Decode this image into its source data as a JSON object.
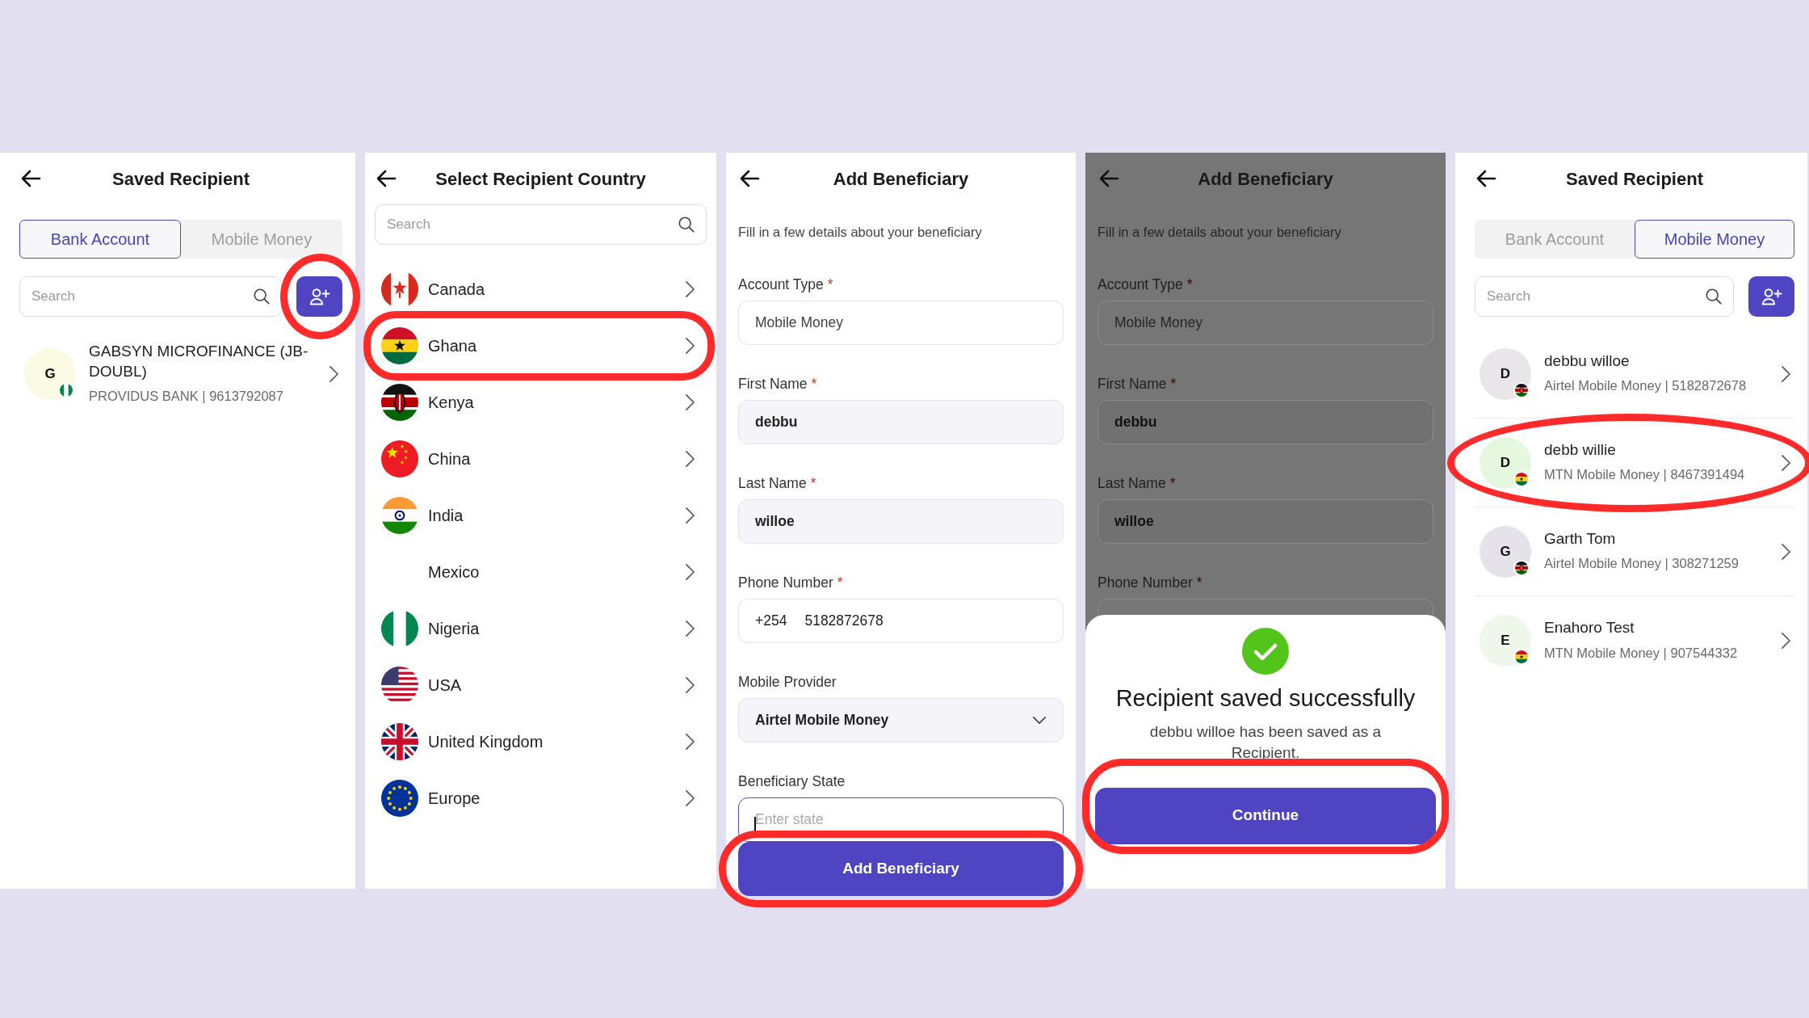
{
  "screens": [
    {
      "kind": "recipients",
      "title": "Saved Recipient",
      "tabs": [
        {
          "label": "Bank Account",
          "selected": true
        },
        {
          "label": "Mobile Money",
          "selected": false
        }
      ],
      "search": {
        "placeholder": "Search"
      },
      "add_button": {
        "highlighted": true
      },
      "recipients": [
        {
          "initial": "G",
          "name": "GABSYN MICROFINANCE (JB-DOUBL)",
          "detail": "PROVIDUS BANK | 9613792087",
          "color": "#fbfbe4",
          "kind": "nigeria",
          "highlighted": false
        }
      ]
    },
    {
      "kind": "countries",
      "title": "Select Recipient Country",
      "search": {
        "placeholder": "Search"
      },
      "countries": [
        {
          "name": "Canada",
          "kind": "canada",
          "highlighted": false
        },
        {
          "name": "Ghana",
          "kind": "ghana",
          "highlighted": true
        },
        {
          "name": "Kenya",
          "kind": "kenya",
          "highlighted": false
        },
        {
          "name": "China",
          "kind": "china",
          "highlighted": false
        },
        {
          "name": "India",
          "kind": "india",
          "highlighted": false
        },
        {
          "name": "Mexico",
          "highlighted": false
        },
        {
          "name": "Nigeria",
          "kind": "nigeria",
          "highlighted": false
        },
        {
          "name": "USA",
          "kind": "usa",
          "highlighted": false
        },
        {
          "name": "United Kingdom",
          "kind": "uk",
          "highlighted": false
        },
        {
          "name": "Europe",
          "kind": "europe",
          "highlighted": false
        }
      ]
    },
    {
      "kind": "form",
      "title": "Add Beneficiary",
      "dimmed": false,
      "subtitle": "Fill in a few details about your beneficiary",
      "fields": [
        {
          "kind": "static",
          "label": "Account Type",
          "required_mark": "*",
          "value": "Mobile Money"
        },
        {
          "kind": "text",
          "label": "First Name",
          "required_mark": "*",
          "value": "debbu"
        },
        {
          "kind": "text",
          "label": "Last Name",
          "required_mark": "*",
          "value": "willoe"
        },
        {
          "kind": "phone",
          "label": "Phone Number",
          "required_mark": "*",
          "prefix": "+254",
          "value": "5182872678"
        },
        {
          "kind": "select",
          "label": "Mobile Provider",
          "value": "Airtel Mobile Money"
        },
        {
          "kind": "input",
          "label": "Beneficiary State",
          "placeholder": "Enter state",
          "focused": true
        }
      ],
      "submit": {
        "label": "Add Beneficiary",
        "highlighted": true
      }
    },
    {
      "kind": "form",
      "title": "Add Beneficiary",
      "dimmed": true,
      "subtitle": "Fill in a few details about your beneficiary",
      "fields": [
        {
          "kind": "static",
          "label": "Account Type",
          "required_mark": "*",
          "value": "Mobile Money"
        },
        {
          "kind": "text",
          "label": "First Name",
          "required_mark": "*",
          "value": "debbu"
        },
        {
          "kind": "text",
          "label": "Last Name",
          "required_mark": "*",
          "value": "willoe"
        },
        {
          "kind": "phone",
          "label": "Phone Number",
          "required_mark": "*"
        }
      ],
      "dialog": {
        "title": "Recipient saved successfully",
        "message": "debbu willoe has been saved as a Recipient.",
        "button": {
          "label": "Continue",
          "highlighted": true
        }
      }
    },
    {
      "kind": "recipients",
      "title": "Saved Recipient",
      "tabs": [
        {
          "label": "Bank Account",
          "selected": false
        },
        {
          "label": "Mobile Money",
          "selected": true
        }
      ],
      "search": {
        "placeholder": "Search"
      },
      "add_button": {
        "highlighted": false
      },
      "recipients": [
        {
          "initial": "D",
          "name": "debbu willoe",
          "detail": "Airtel Mobile Money | 5182872678",
          "color": "#e8e6e8",
          "kind": "kenya",
          "highlighted": false
        },
        {
          "initial": "D",
          "name": "debb willie",
          "detail": "MTN Mobile Money | 8467391494",
          "color": "#e5f7df",
          "kind": "ghana",
          "highlighted": true
        },
        {
          "initial": "G",
          "name": "Garth Tom",
          "detail": "Airtel Mobile Money | 308271259",
          "color": "#e5e2ea",
          "kind": "kenya",
          "highlighted": false
        },
        {
          "initial": "E",
          "name": "Enahoro  Test",
          "detail": "MTN Mobile Money | 907544332",
          "color": "#eef7ea",
          "kind": "ghana",
          "highlighted": false
        }
      ]
    }
  ]
}
